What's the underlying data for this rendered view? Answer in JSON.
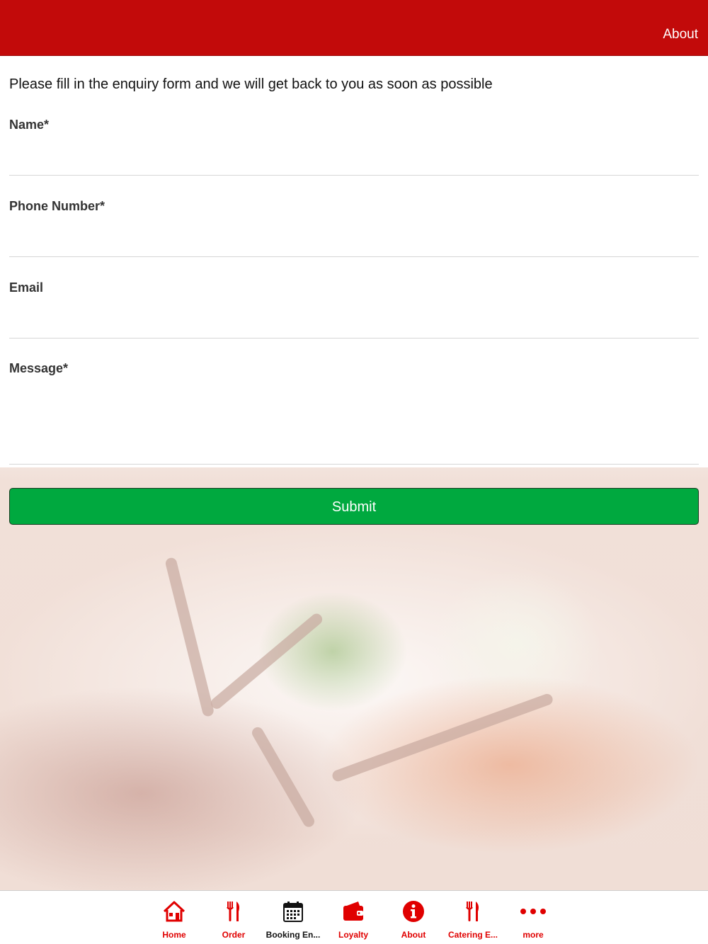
{
  "header": {
    "title": "About"
  },
  "form": {
    "intro": "Please fill in the enquiry form and we will get back to you as soon as possible",
    "fields": [
      {
        "label": "Name*",
        "value": ""
      },
      {
        "label": "Phone Number*",
        "value": ""
      },
      {
        "label": "Email",
        "value": ""
      },
      {
        "label": "Message*",
        "value": ""
      }
    ],
    "submit_label": "Submit"
  },
  "tabbar": {
    "items": [
      {
        "label": "Home",
        "icon": "home-icon"
      },
      {
        "label": "Order",
        "icon": "fork-knife-icon"
      },
      {
        "label": "Booking En...",
        "icon": "calendar-icon"
      },
      {
        "label": "Loyalty",
        "icon": "wallet-icon"
      },
      {
        "label": "About",
        "icon": "info-icon"
      },
      {
        "label": "Catering E...",
        "icon": "fork-knife-icon"
      },
      {
        "label": "more",
        "icon": "more-dots-icon"
      }
    ]
  },
  "colors": {
    "header": "#c20a0a",
    "accent": "#e00000",
    "submit": "#00a93f"
  }
}
